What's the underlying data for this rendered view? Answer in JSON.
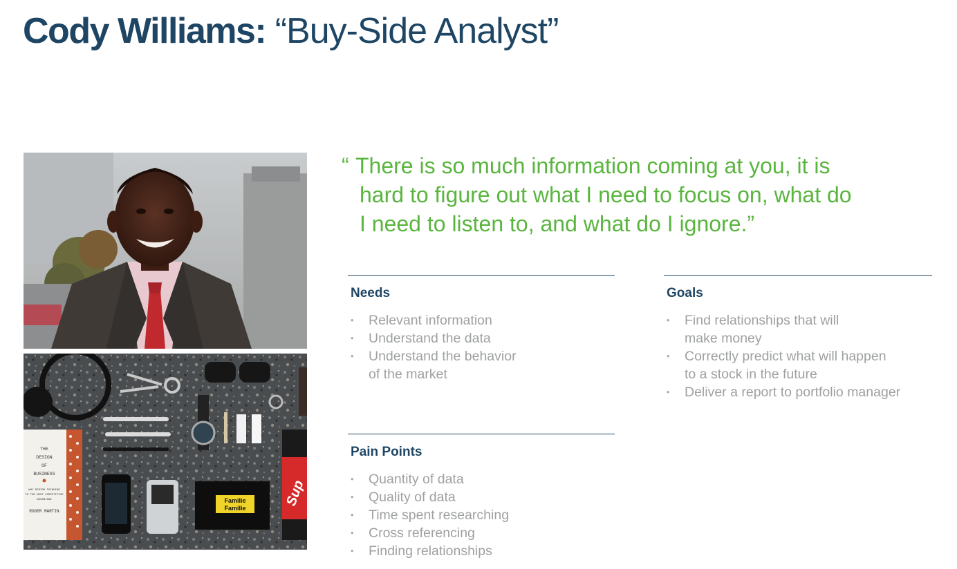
{
  "title": {
    "name": "Cody Williams:",
    "role": "“Buy-Side Analyst”"
  },
  "quote": {
    "open_mark": "“",
    "lines": [
      "There is so much information coming at you, it is",
      "hard to figure out what I need to focus on, what do",
      "I need to listen to, and what do I ignore.”"
    ]
  },
  "needs": {
    "heading": "Needs",
    "items": [
      [
        "Relevant information"
      ],
      [
        "Understand the data"
      ],
      [
        "Understand the behavior",
        "of the market"
      ]
    ]
  },
  "goals": {
    "heading": "Goals",
    "items": [
      [
        "Find relationships that will",
        "make money"
      ],
      [
        "Correctly predict what will happen",
        "to a stock in the future"
      ],
      [
        "Deliver a report to portfolio manager"
      ]
    ]
  },
  "pain_points": {
    "heading": "Pain Points",
    "items": [
      [
        "Quantity of data"
      ],
      [
        "Quality of data"
      ],
      [
        "Time spent researching"
      ],
      [
        "Cross referencing"
      ],
      [
        "Finding relationships"
      ]
    ]
  },
  "bullet_glyph": "•",
  "book": {
    "lines": [
      "THE",
      "DESIGN",
      "OF",
      "BUSINESS"
    ],
    "subtitle": [
      "WHY DESIGN THINKING",
      "IS THE NEXT COMPETITIVE",
      "ADVANTAGE"
    ],
    "author": "ROGER MARTIN"
  },
  "notebook_label": [
    "Familie",
    "Familie"
  ],
  "red_bag_text": "Sup",
  "colors": {
    "title": "#1e4664",
    "quote": "#5ab53f",
    "body_text": "#9ea0a2"
  }
}
